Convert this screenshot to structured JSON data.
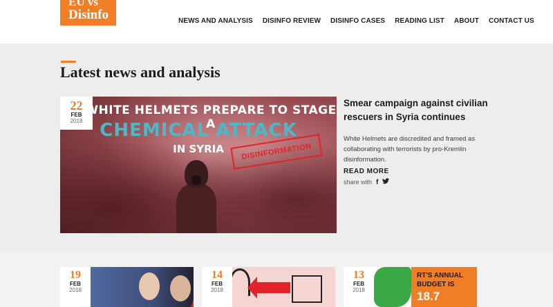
{
  "header": {
    "logo_line1": "EU vs",
    "logo_line2": "Disinfo",
    "nav": [
      "NEWS AND ANALYSIS",
      "DISINFO REVIEW",
      "DISINFO CASES",
      "READING LIST",
      "ABOUT",
      "CONTACT US"
    ]
  },
  "section_title": "Latest news and analysis",
  "featured": {
    "date": {
      "day": "22",
      "month": "FEB",
      "year": "2018"
    },
    "image_text": {
      "line1": "WHITE HELMETS PREPARE TO STAGE A",
      "line2": "CHEMICAL ATTACK",
      "line3": "IN SYRIA",
      "stamp": "DISINFORMATION"
    },
    "title": "Smear campaign against civilian rescuers in Syria continues",
    "description": "White Helmets are discredited and framed as collaborating with terrorists by pro-Kremlin disinformation.",
    "read_more": "READ MORE",
    "share_label": "share with",
    "share_icons": [
      "facebook-icon",
      "twitter-icon"
    ]
  },
  "cards": [
    {
      "date": {
        "day": "19",
        "month": "FEB",
        "year": "2018"
      }
    },
    {
      "date": {
        "day": "14",
        "month": "FEB",
        "year": "2018"
      }
    },
    {
      "date": {
        "day": "13",
        "month": "FEB",
        "year": "2018"
      },
      "text1": "RT'S ANNUAL",
      "text2": "BUDGET IS",
      "text3": "18.7"
    }
  ],
  "colors": {
    "accent": "#f07e26",
    "background": "#ededed"
  }
}
